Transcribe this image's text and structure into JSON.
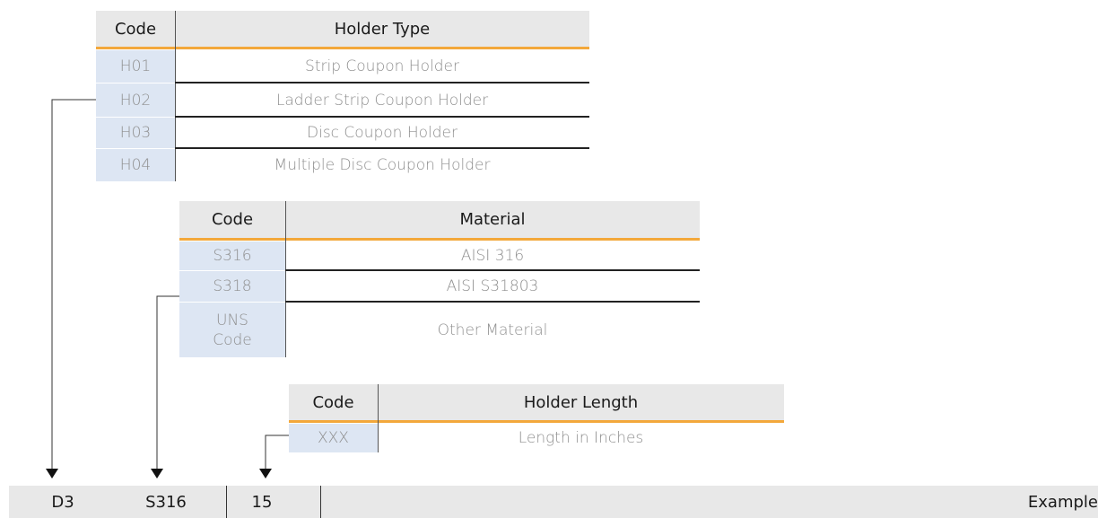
{
  "holder_type_table": {
    "header": {
      "code": "Code",
      "desc": "Holder Type"
    },
    "rows": [
      {
        "code": "H01",
        "desc": "Strip Coupon Holder"
      },
      {
        "code": "H02",
        "desc": "Ladder Strip Coupon Holder"
      },
      {
        "code": "H03",
        "desc": "Disc Coupon Holder"
      },
      {
        "code": "H04",
        "desc": "Multiple Disc Coupon Holder"
      }
    ]
  },
  "material_table": {
    "header": {
      "code": "Code",
      "desc": "Material"
    },
    "rows": [
      {
        "code": "S316",
        "desc": "AISI 316"
      },
      {
        "code": "S318",
        "desc": "AISI S31803"
      },
      {
        "code": "UNS\nCode",
        "desc": "Other Material"
      }
    ]
  },
  "length_table": {
    "header": {
      "code": "Code",
      "desc": "Holder Length"
    },
    "rows": [
      {
        "code": "XXX",
        "desc": "Length in Inches"
      }
    ]
  },
  "example_bar": {
    "parts": [
      "D3",
      "S316",
      "15"
    ],
    "label": "Example"
  },
  "colors": {
    "accent_underline": "#f3a83b",
    "code_cell_bg": "#dde6f3",
    "header_bg": "#e8e8e8"
  }
}
